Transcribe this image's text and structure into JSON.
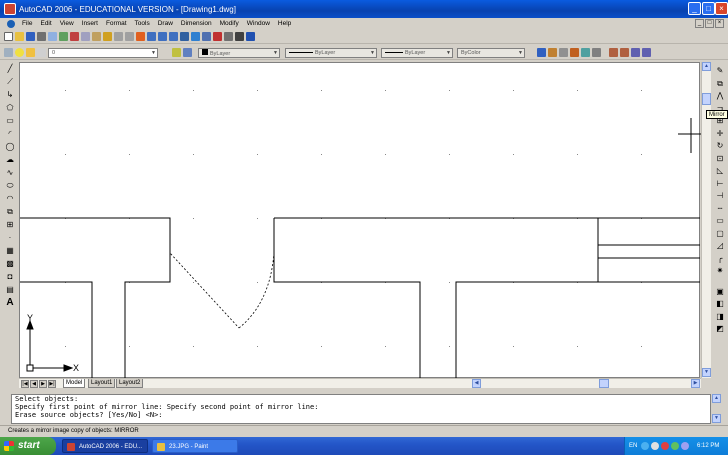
{
  "window": {
    "title": "AutoCAD 2006 - EDUCATIONAL VERSION - [Drawing1.dwg]",
    "controls": {
      "minimize": "_",
      "maximize": "□",
      "close": "×"
    }
  },
  "menubar": {
    "items": [
      "File",
      "Edit",
      "View",
      "Insert",
      "Format",
      "Tools",
      "Draw",
      "Dimension",
      "Modify",
      "Window",
      "Help"
    ]
  },
  "toolbars": {
    "layer_value": "0",
    "color_combo": "ByLayer",
    "linetype_combo": "ByLayer",
    "lineweight_combo": "ByLayer",
    "plotstyle_combo": "ByColor"
  },
  "tooltip": "Mirror",
  "ucs": {
    "x_label": "X",
    "y_label": "Y"
  },
  "layout_tabs": [
    "Model",
    "Layout1",
    "Layout2"
  ],
  "nav_arrows": [
    "|◀",
    "◀",
    "▶",
    "▶|"
  ],
  "command": {
    "lines": [
      "Select objects:",
      "Specify first point of mirror line: Specify second point of mirror line:",
      "Erase source objects? [Yes/No] <N>:"
    ]
  },
  "status_text": "Creates a mirror image copy of objects:  MIRROR",
  "taskbar": {
    "start_label": "start",
    "tasks": [
      "AutoCAD 2006 - EDU...",
      "23.JPG - Paint"
    ],
    "language": "EN",
    "clock": "6:12 PM"
  },
  "colors": {
    "titlebar": "#0a5be0",
    "taskbar": "#2456c8",
    "start": "#3a9a36",
    "canvas": "#ffffff"
  }
}
